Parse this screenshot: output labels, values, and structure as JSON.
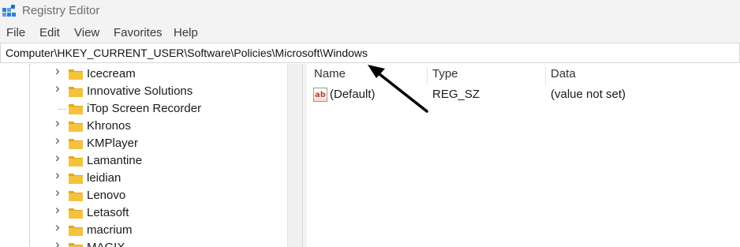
{
  "window": {
    "title": "Registry Editor"
  },
  "menu": [
    "File",
    "Edit",
    "View",
    "Favorites",
    "Help"
  ],
  "address": {
    "path": "Computer\\HKEY_CURRENT_USER\\Software\\Policies\\Microsoft\\Windows"
  },
  "tree": {
    "items": [
      {
        "label": "Icecream",
        "expandable": true
      },
      {
        "label": "Innovative Solutions",
        "expandable": true
      },
      {
        "label": "iTop Screen Recorder",
        "expandable": false
      },
      {
        "label": "Khronos",
        "expandable": true
      },
      {
        "label": "KMPlayer",
        "expandable": true
      },
      {
        "label": "Lamantine",
        "expandable": true
      },
      {
        "label": "leidian",
        "expandable": true
      },
      {
        "label": "Lenovo",
        "expandable": true
      },
      {
        "label": "Letasoft",
        "expandable": true
      },
      {
        "label": "macrium",
        "expandable": true
      },
      {
        "label": "MAGIX",
        "expandable": true
      }
    ]
  },
  "values": {
    "columns": {
      "name": "Name",
      "type": "Type",
      "data": "Data"
    },
    "rows": [
      {
        "name": "(Default)",
        "type": "REG_SZ",
        "data": "(value not set)",
        "icon": "string-value-icon"
      }
    ]
  },
  "colors": {
    "folder": "#f5c23e",
    "folder_dark": "#e0a820",
    "app_icon": "#2b7fd4",
    "string_icon": "#c0392b",
    "annotation_arrow": "#000000"
  }
}
